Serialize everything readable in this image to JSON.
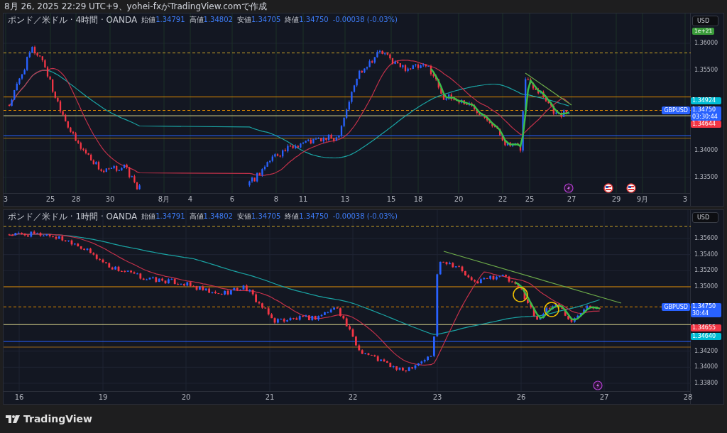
{
  "caption": "8月 26, 2025 22:29 UTC+9、yohei-fxがTradingView.comで作成",
  "panels": [
    {
      "legend": {
        "symbol": "ポンド／米ドル · 4時間 · OANDA",
        "fields": [
          {
            "label": "始値",
            "value": "1.34791"
          },
          {
            "label": "高値",
            "value": "1.34802"
          },
          {
            "label": "安値",
            "value": "1.34705"
          },
          {
            "label": "終値",
            "value": "1.34750"
          }
        ],
        "change": "-0.00038 (-0.03%)"
      },
      "currency": "USD",
      "scale_badge": "1e+21",
      "price_ticks": [
        "1.36000",
        "1.35500",
        "1.34000",
        "1.33500"
      ],
      "badges": [
        {
          "text": "1.34924",
          "color": "#00bcd4"
        },
        {
          "text": "1.34750",
          "sub": "03:30:44",
          "tag": "GBPUSD",
          "color": "#2962ff"
        },
        {
          "text": "1.34644",
          "color": "#f23645"
        }
      ],
      "time_labels": [
        "3",
        "25",
        "28",
        "30",
        "8月",
        "4",
        "6",
        "8",
        "11",
        "13",
        "15",
        "18",
        "20",
        "22",
        "25",
        "27",
        "29",
        "9月",
        "3"
      ]
    },
    {
      "legend": {
        "symbol": "ポンド／米ドル · 1時間 · OANDA",
        "fields": [
          {
            "label": "始値",
            "value": "1.34791"
          },
          {
            "label": "高値",
            "value": "1.34802"
          },
          {
            "label": "安値",
            "value": "1.34705"
          },
          {
            "label": "終値",
            "value": "1.34750"
          }
        ],
        "change": "-0.00038 (-0.03%)"
      },
      "currency": "USD",
      "price_ticks": [
        "1.35600",
        "1.35400",
        "1.35200",
        "1.35000",
        "1.34200",
        "1.34000",
        "1.33800"
      ],
      "badges": [
        {
          "text": "1.34750",
          "sub": "30:44",
          "tag": "GBPUSD",
          "color": "#2962ff"
        },
        {
          "text": "1.34655",
          "color": "#f23645"
        },
        {
          "text": "1.34640",
          "color": "#00bcd4"
        }
      ],
      "time_labels": [
        "16",
        "19",
        "20",
        "21",
        "22",
        "23",
        "26",
        "27",
        "28"
      ]
    }
  ],
  "footer": {
    "brand": "TradingView"
  }
}
